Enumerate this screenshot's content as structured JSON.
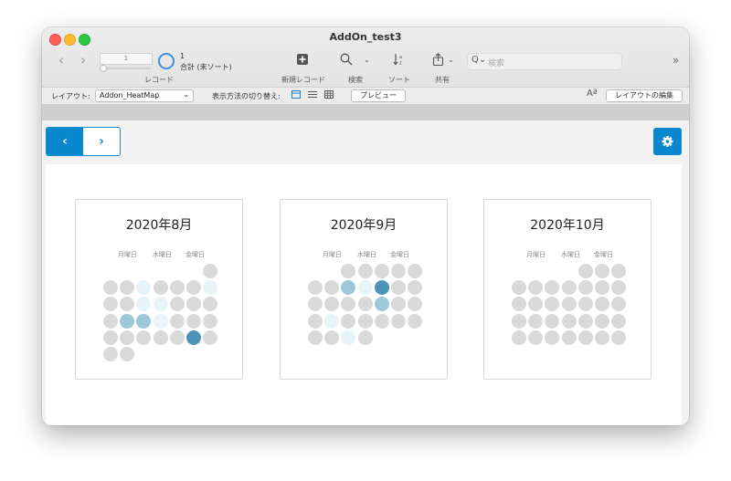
{
  "window": {
    "title": "AddOn_test3"
  },
  "toolbar": {
    "record_field": "1",
    "record_label": "レコード",
    "found_count": "1",
    "total_sort": "合計 (未ソート)",
    "new_record_label": "新規レコード",
    "find_label": "検索",
    "sort_label": "ソート",
    "share_label": "共有",
    "search_placeholder": "検索"
  },
  "layoutbar": {
    "layout_prefix": "レイアウト:",
    "layout_name": "Addon_HeatMap",
    "view_as": "表示方法の切り替え:",
    "preview": "プレビュー",
    "edit_layout": "レイアウトの編集",
    "font_glyph": "Aª"
  },
  "nav": {
    "prev_glyph": "‹",
    "next_glyph": "›"
  },
  "colors": {
    "accent": "#0a88cf",
    "empty_cell": "#d9d9d9",
    "level1": "#e6f4f8",
    "level2": "#9cc8da",
    "level3": "#4d93b8"
  },
  "calendars": [
    {
      "title": "2020年8月",
      "weekday_labels": [
        "月曜日",
        "水曜日",
        "金曜日"
      ],
      "weeks": [
        [
          null,
          null,
          null,
          null,
          null,
          null,
          0
        ],
        [
          0,
          0,
          1,
          0,
          0,
          0,
          1
        ],
        [
          0,
          0,
          1,
          1,
          0,
          0,
          0
        ],
        [
          0,
          2,
          2,
          1,
          0,
          0,
          0
        ],
        [
          0,
          0,
          0,
          0,
          0,
          3,
          0
        ],
        [
          0,
          0,
          null,
          null,
          null,
          null,
          null
        ]
      ]
    },
    {
      "title": "2020年9月",
      "weekday_labels": [
        "月曜日",
        "水曜日",
        "金曜日"
      ],
      "weeks": [
        [
          null,
          null,
          0,
          0,
          0,
          0,
          0
        ],
        [
          0,
          0,
          2,
          1,
          3,
          0,
          0
        ],
        [
          0,
          0,
          0,
          0,
          2,
          0,
          0
        ],
        [
          0,
          1,
          0,
          0,
          0,
          0,
          0
        ],
        [
          0,
          0,
          1,
          0,
          null,
          null,
          null
        ]
      ]
    },
    {
      "title": "2020年10月",
      "weekday_labels": [
        "月曜日",
        "水曜日",
        "金曜日"
      ],
      "weeks": [
        [
          null,
          null,
          null,
          null,
          0,
          0,
          0
        ],
        [
          0,
          0,
          0,
          0,
          0,
          0,
          0
        ],
        [
          0,
          0,
          0,
          0,
          0,
          0,
          0
        ],
        [
          0,
          0,
          0,
          0,
          0,
          0,
          0
        ],
        [
          0,
          0,
          0,
          0,
          0,
          0,
          0
        ]
      ]
    }
  ]
}
